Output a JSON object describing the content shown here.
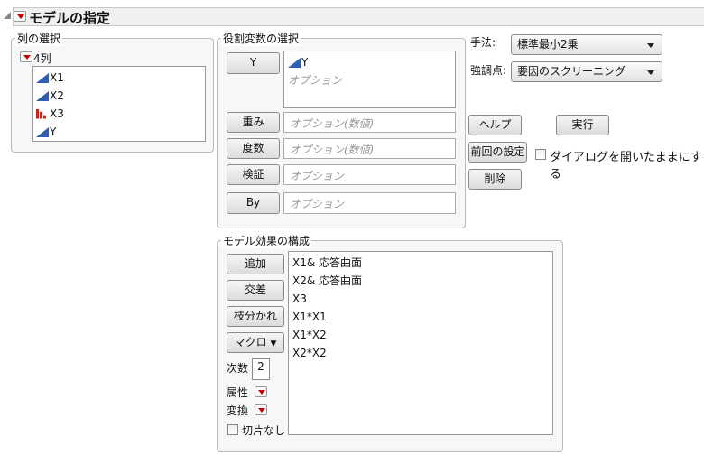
{
  "header": {
    "title": "モデルの指定"
  },
  "columns": {
    "label": "列の選択",
    "count_label": "4列",
    "items": [
      {
        "name": "X1",
        "type": "continuous"
      },
      {
        "name": "X2",
        "type": "continuous"
      },
      {
        "name": "X3",
        "type": "nominal"
      },
      {
        "name": "Y",
        "type": "continuous"
      }
    ]
  },
  "roles": {
    "label": "役割変数の選択",
    "y": {
      "button": "Y",
      "value": "Y",
      "placeholder": "オプション"
    },
    "weight": {
      "button": "重み",
      "placeholder": "オプション(数値)"
    },
    "freq": {
      "button": "度数",
      "placeholder": "オプション(数値)"
    },
    "validation": {
      "button": "検証",
      "placeholder": "オプション"
    },
    "by": {
      "button": "By",
      "placeholder": "オプション"
    }
  },
  "settings": {
    "method_label": "手法:",
    "method_value": "標準最小2乗",
    "emphasis_label": "強調点:",
    "emphasis_value": "要因のスクリーニング"
  },
  "actions": {
    "help": "ヘルプ",
    "run": "実行",
    "recall": "前回の設定",
    "keep_open": "ダイアログを開いたままにする",
    "keep_open_checked": false,
    "remove": "削除"
  },
  "effects": {
    "label": "モデル効果の構成",
    "add": "追加",
    "cross": "交差",
    "nest": "枝分かれ",
    "macros": "マクロ",
    "degree_label": "次数",
    "degree_value": "2",
    "attributes_label": "属性",
    "transform_label": "変換",
    "no_intercept": "切片なし",
    "no_intercept_checked": false,
    "items": [
      "X1& 応答曲面",
      "X2& 応答曲面",
      "X3",
      "X1*X1",
      "X1*X2",
      "X2*X2"
    ]
  }
}
